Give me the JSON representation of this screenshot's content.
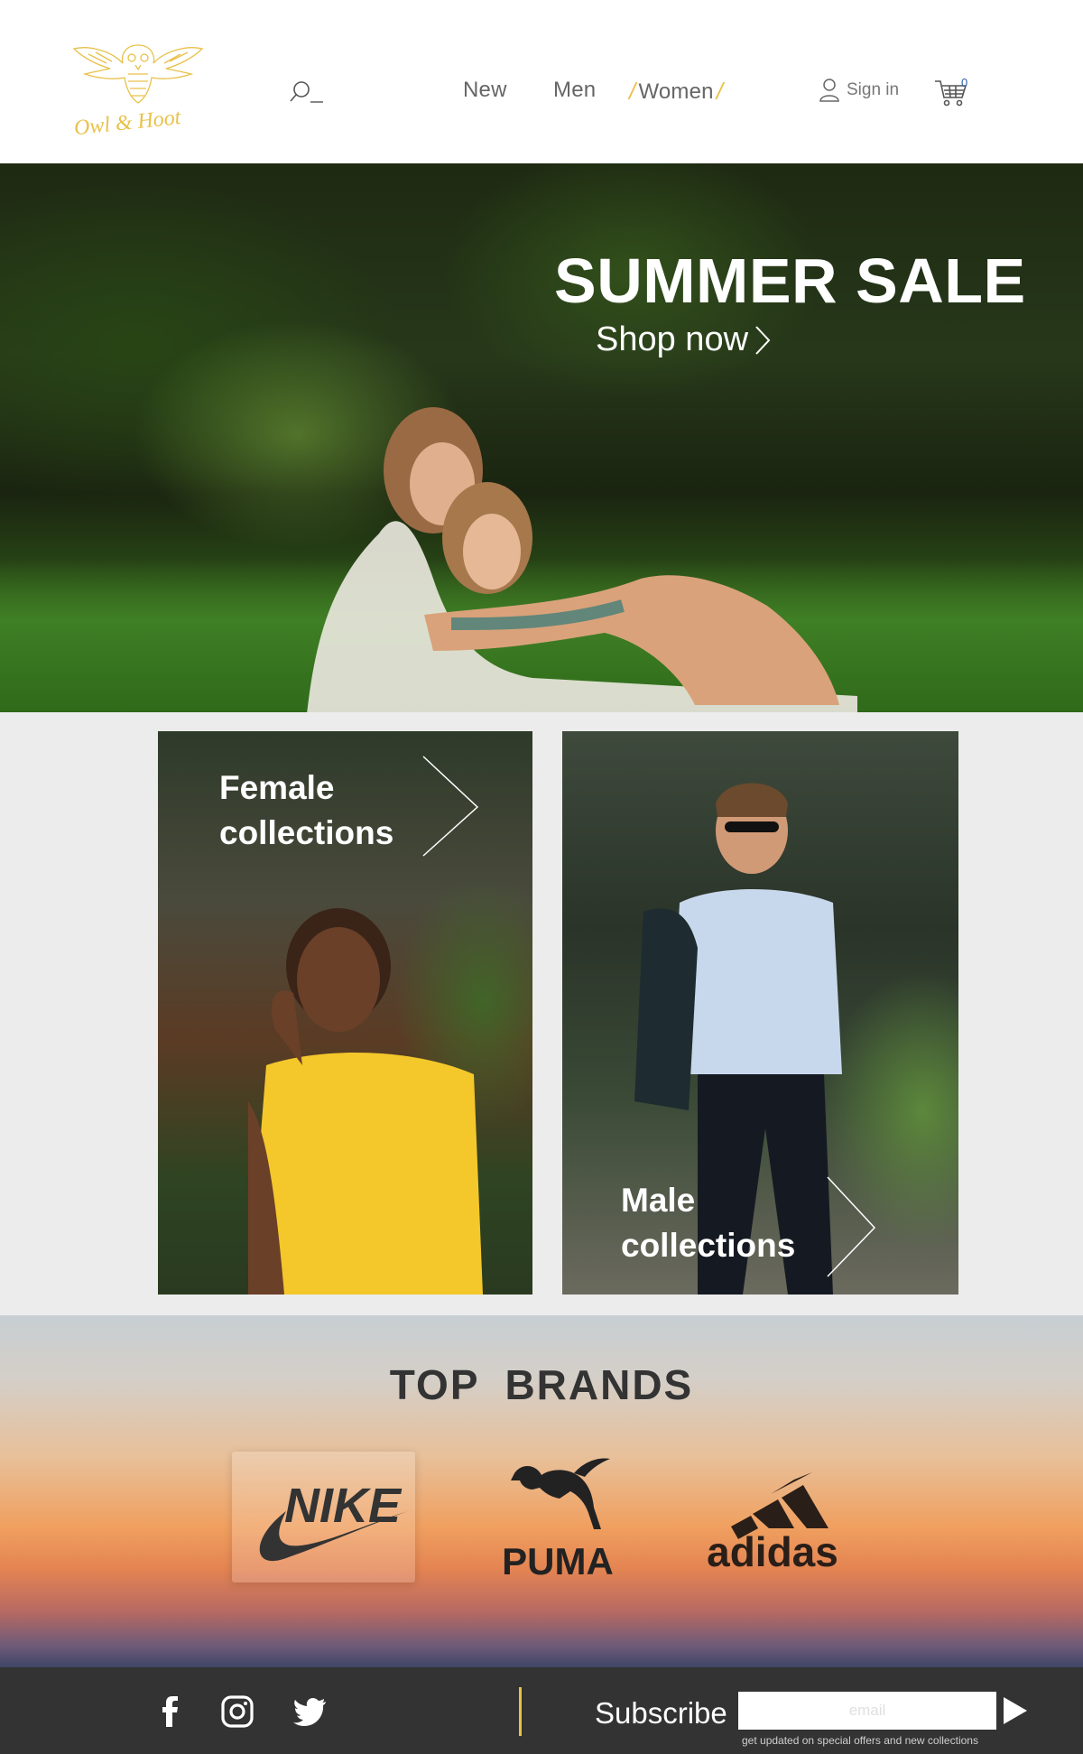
{
  "colors": {
    "accent": "#e9c14a",
    "footer_bg": "#333333",
    "collections_bg": "#ececec",
    "cart_count": "#2c5fa7"
  },
  "header": {
    "logo_text": "Owl & Hoot",
    "search_icon": "search-icon",
    "nav": [
      {
        "label": "New"
      },
      {
        "label": "Men"
      },
      {
        "label": "Women",
        "active": true
      }
    ],
    "signin_label": "Sign in",
    "user_icon": "user-icon",
    "cart_icon": "cart-icon",
    "cart_count": "0"
  },
  "hero": {
    "title": "SUMMER SALE",
    "cta": "Shop now"
  },
  "collections": {
    "female": {
      "line1": "Female",
      "line2": "collections"
    },
    "male": {
      "line1": "Male",
      "line2": "collections"
    }
  },
  "brands": {
    "title": "TOP  BRANDS",
    "items": [
      {
        "name": "NIKE",
        "icon": "nike-logo"
      },
      {
        "name": "PUMA",
        "icon": "puma-logo"
      },
      {
        "name": "adidas",
        "icon": "adidas-logo"
      }
    ]
  },
  "footer": {
    "social": [
      "facebook-icon",
      "instagram-icon",
      "twitter-icon"
    ],
    "subscribe_label": "Subscribe",
    "email_placeholder": "email",
    "note": "get updated on special offers and new collections"
  }
}
